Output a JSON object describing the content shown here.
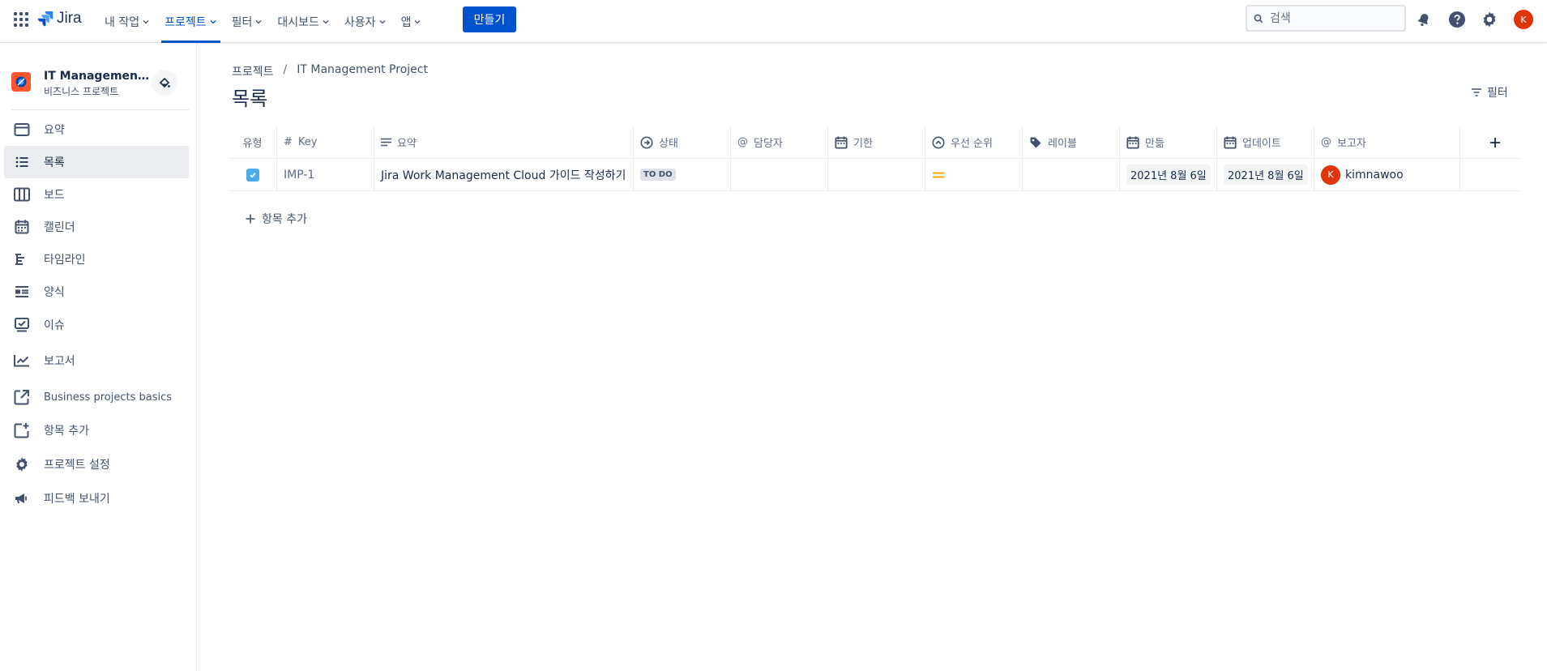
{
  "topnav": {
    "logo": "Jira",
    "items": [
      {
        "label": "내 작업"
      },
      {
        "label": "프로젝트"
      },
      {
        "label": "필터"
      },
      {
        "label": "대시보드"
      },
      {
        "label": "사용자"
      },
      {
        "label": "앱"
      }
    ],
    "active_item": "프로젝트",
    "create_label": "만들기",
    "search_placeholder": "검색",
    "user_initial": "K",
    "colors": {
      "accent": "#0052cc",
      "avatar": "#de350b"
    }
  },
  "sidebar": {
    "project_name": "IT Management...",
    "project_type": "비즈니스 프로젝트",
    "items": [
      {
        "label": "요약",
        "icon": "summary-icon"
      },
      {
        "label": "목록",
        "icon": "list-icon",
        "selected": true
      },
      {
        "label": "보드",
        "icon": "board-icon"
      },
      {
        "label": "캘린더",
        "icon": "calendar-icon"
      },
      {
        "label": "타임라인",
        "icon": "timeline-icon"
      },
      {
        "label": "양식",
        "icon": "form-icon"
      },
      {
        "label": "이슈",
        "icon": "issues-icon"
      },
      {
        "label": "보고서",
        "icon": "reports-icon"
      },
      {
        "label": "Business projects basics",
        "icon": "external-link-icon"
      },
      {
        "label": "항목 추가",
        "icon": "add-item-icon"
      },
      {
        "label": "프로젝트 설정",
        "icon": "settings-icon"
      },
      {
        "label": "피드백 보내기",
        "icon": "megaphone-icon"
      }
    ]
  },
  "main": {
    "breadcrumb": [
      "프로젝트",
      "IT Management Project"
    ],
    "title": "목록",
    "filter_label": "필터",
    "columns": {
      "type": "유형",
      "key": "Key",
      "summary": "요약",
      "status": "상태",
      "assignee": "담당자",
      "due": "기한",
      "priority": "우선 순위",
      "labels": "레이블",
      "created": "만듦",
      "updated": "업데이트",
      "reporter": "보고자"
    },
    "rows": [
      {
        "key": "IMP-1",
        "summary": "Jira Work Management Cloud 가이드 작성하기",
        "status": "TO DO",
        "assignee": "",
        "due": "",
        "priority": "medium",
        "labels": "",
        "created": "2021년 8월 6일",
        "updated": "2021년 8월 6일",
        "reporter": "kimnawoo",
        "reporter_initial": "K"
      }
    ],
    "add_item_label": "항목 추가"
  }
}
